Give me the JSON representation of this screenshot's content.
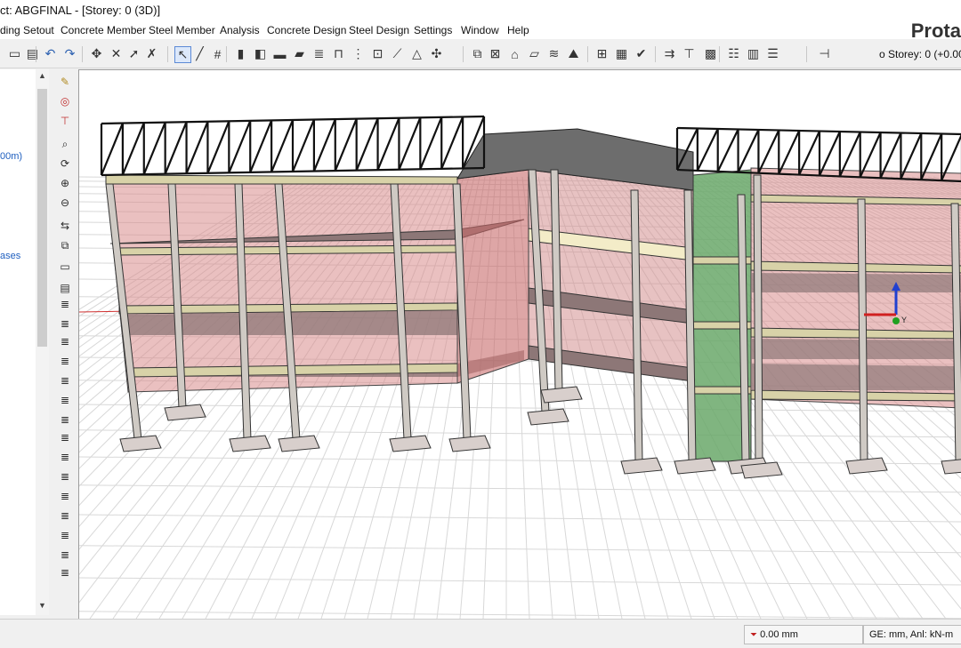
{
  "window": {
    "title": "ct: ABGFINAL - [Storey: 0 (3D)]"
  },
  "brand": "Prota",
  "menu": [
    {
      "label": "ding Setout"
    },
    {
      "label": "Concrete Member"
    },
    {
      "label": "Steel Member"
    },
    {
      "label": "Analysis"
    },
    {
      "label": "Concrete Design"
    },
    {
      "label": "Steel Design"
    },
    {
      "label": "Settings"
    },
    {
      "label": "Window"
    },
    {
      "label": "Help"
    }
  ],
  "toolbar": {
    "storey_label": "Storey: 0 (+0.00",
    "storey_bullet": "o",
    "icons": [
      "folder-icon",
      "save-icon",
      "undo-icon",
      "redo-icon",
      "node-icon",
      "delete-icon",
      "select-icon",
      "remove-icon",
      "pointer-icon",
      "line-icon",
      "grid-icon",
      "column-icon",
      "wall-icon",
      "beam-icon",
      "slab-icon",
      "stair-icon",
      "frame-icon",
      "rebar-icon",
      "opening-icon",
      "brace-icon",
      "truss-icon",
      "move-icon",
      "copy-icon",
      "measure-icon",
      "roof-icon",
      "footing-icon",
      "pile-icon",
      "mountain-icon",
      "rafter-icon",
      "lattice-icon",
      "check-icon",
      "load-icon",
      "support-icon",
      "mesh-icon",
      "table-icon",
      "layers-icon",
      "list-icon",
      "storey-icon"
    ]
  },
  "left_panel": {
    "fragment_1": "00m)",
    "fragment_2": "ases"
  },
  "vtoolbar": {
    "icons": [
      "pencil-icon",
      "globe-icon",
      "dimension-icon",
      "zoom-icon",
      "rotate-icon",
      "zoom-in-icon",
      "zoom-out-icon",
      "pan-icon",
      "view-icon",
      "section-icon",
      "layer-icon",
      "stack-icon",
      "stack-icon",
      "stack-icon",
      "stack-icon",
      "stack-icon",
      "stack-icon",
      "stack-icon",
      "stack-icon",
      "stack-icon",
      "stack-icon",
      "stack-icon",
      "stack-icon",
      "stack-icon",
      "stack-icon",
      "stack-icon"
    ]
  },
  "status": {
    "elevation": "0.00 mm",
    "units": "GE: mm,  Anl: kN-m"
  },
  "colors": {
    "viewport_bg": "#ffffff",
    "grid": "#d8d8d8",
    "wall_red": "#c85a5a",
    "slab": "#8d7b7b",
    "beam": "#d8d2a8",
    "column": "#b5b0aa",
    "core_green": "#6aa86a",
    "truss": "#111111",
    "roof": "#6d6d6d"
  }
}
